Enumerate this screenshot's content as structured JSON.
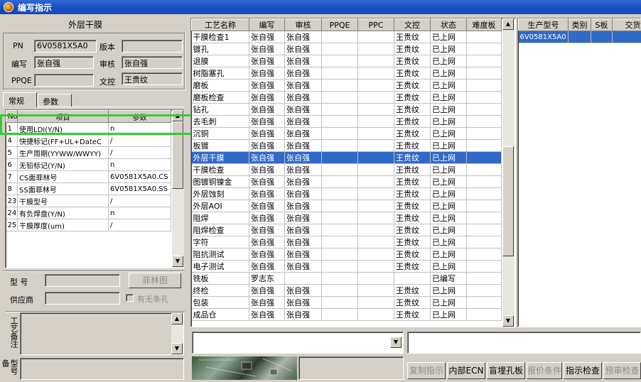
{
  "window": {
    "title": "编写指示"
  },
  "left": {
    "section_title": "外层干膜",
    "fields": {
      "pn_label": "PN",
      "pn_value": "6V0581X5A0",
      "version_label": "版本",
      "version_value": "",
      "writer_label": "编写",
      "writer_value": "张自强",
      "reviewer_label": "审核",
      "reviewer_value": "张自强",
      "ppqe_label": "PPQE",
      "ppqe_value": "",
      "doc_label": "文控",
      "doc_value": "王贵纹"
    },
    "tabs": [
      "常规",
      "参数"
    ],
    "param_table": {
      "headers": [
        "No",
        "项目",
        "参数"
      ],
      "rows": [
        [
          "1",
          "使用LDI(Y/N)",
          "n"
        ],
        [
          "4",
          "快捷标记(FF+UL+DateC",
          "/"
        ],
        [
          "5",
          "生产周期(YYWW/WWYY)",
          "/"
        ],
        [
          "6",
          "无铅标记(Y/N)",
          "n"
        ],
        [
          "7",
          "CS面菲林号",
          "6V0581X5A0.CS"
        ],
        [
          "8",
          "SS面菲林号",
          "6V0581X5A0.SS"
        ],
        [
          "23",
          "干膜型号",
          "/"
        ],
        [
          "24",
          "有负焊盘(Y/N)",
          "n"
        ],
        [
          "25",
          "干膜厚度(um)",
          "/"
        ]
      ]
    },
    "model_label": "型  号",
    "film_button": "菲林图",
    "supplier_label": "供应商",
    "barcode_checkbox": "有无条孔",
    "process_note_label": "工艺备注",
    "model_note_label": "型号备"
  },
  "process_table": {
    "headers": [
      "工艺名称",
      "编写",
      "审核",
      "PPQE",
      "PPC",
      "文控",
      "状态",
      "难度板"
    ],
    "selected_index": 10,
    "rows": [
      [
        "干膜检查1",
        "张自强",
        "张自强",
        "",
        "",
        "王贵纹",
        "已上网",
        ""
      ],
      [
        "镀孔",
        "张自强",
        "张自强",
        "",
        "",
        "王贵纹",
        "已上网",
        ""
      ],
      [
        "退膜",
        "张自强",
        "张自强",
        "",
        "",
        "王贵纹",
        "已上网",
        ""
      ],
      [
        "树脂塞孔",
        "张自强",
        "张自强",
        "",
        "",
        "王贵纹",
        "已上网",
        ""
      ],
      [
        "磨板",
        "张自强",
        "张自强",
        "",
        "",
        "王贵纹",
        "已上网",
        ""
      ],
      [
        "磨板检查",
        "张自强",
        "张自强",
        "",
        "",
        "王贵纹",
        "已上网",
        ""
      ],
      [
        "钻孔",
        "张自强",
        "张自强",
        "",
        "",
        "王贵纹",
        "已上网",
        ""
      ],
      [
        "去毛刺",
        "张自强",
        "张自强",
        "",
        "",
        "王贵纹",
        "已上网",
        ""
      ],
      [
        "沉铜",
        "张自强",
        "张自强",
        "",
        "",
        "王贵纹",
        "已上网",
        ""
      ],
      [
        "板镀",
        "张自强",
        "张自强",
        "",
        "",
        "王贵纹",
        "已上网",
        ""
      ],
      [
        "外层干膜",
        "张自强",
        "张自强",
        "",
        "",
        "王贵纹",
        "已上网",
        ""
      ],
      [
        "干膜检查",
        "张自强",
        "张自强",
        "",
        "",
        "王贵纹",
        "已上网",
        ""
      ],
      [
        "图镀铜镍金",
        "张自强",
        "张自强",
        "",
        "",
        "王贵纹",
        "已上网",
        ""
      ],
      [
        "外层蚀刻",
        "张自强",
        "张自强",
        "",
        "",
        "王贵纹",
        "已上网",
        ""
      ],
      [
        "外层AOI",
        "张自强",
        "张自强",
        "",
        "",
        "王贵纹",
        "已上网",
        ""
      ],
      [
        "阻焊",
        "张自强",
        "张自强",
        "",
        "",
        "王贵纹",
        "已上网",
        ""
      ],
      [
        "阻焊检查",
        "张自强",
        "张自强",
        "",
        "",
        "王贵纹",
        "已上网",
        ""
      ],
      [
        "字符",
        "张自强",
        "张自强",
        "",
        "",
        "王贵纹",
        "已上网",
        ""
      ],
      [
        "阻抗测试",
        "张自强",
        "张自强",
        "",
        "",
        "王贵纹",
        "已上网",
        ""
      ],
      [
        "电子测试",
        "张自强",
        "张自强",
        "",
        "",
        "王贵纹",
        "已上网",
        ""
      ],
      [
        "铣板",
        "罗志东",
        "",
        "",
        "",
        "",
        "已编写",
        ""
      ],
      [
        "终检",
        "张自强",
        "张自强",
        "",
        "",
        "王贵纹",
        "已上网",
        ""
      ],
      [
        "包装",
        "张自强",
        "张自强",
        "",
        "",
        "王贵纹",
        "已上网",
        ""
      ],
      [
        "成品仓",
        "张自强",
        "张自强",
        "",
        "",
        "王贵纹",
        "已上网",
        ""
      ]
    ]
  },
  "model_table": {
    "headers": [
      "生产型号",
      "类别",
      "S板",
      "交货"
    ],
    "rows": [
      [
        "6V0581X5A0",
        "",
        "",
        ""
      ]
    ]
  },
  "buttons": {
    "copy": "复制指示",
    "ecn": "内部ECN",
    "blind": "盲埋孔板",
    "quote": "报价条件",
    "check": "指示检查",
    "precheck": "预审检查"
  },
  "colors": {
    "selection": "#3169c6",
    "highlight_box": "#33cc33",
    "titlebar": "#1a4fc4"
  }
}
